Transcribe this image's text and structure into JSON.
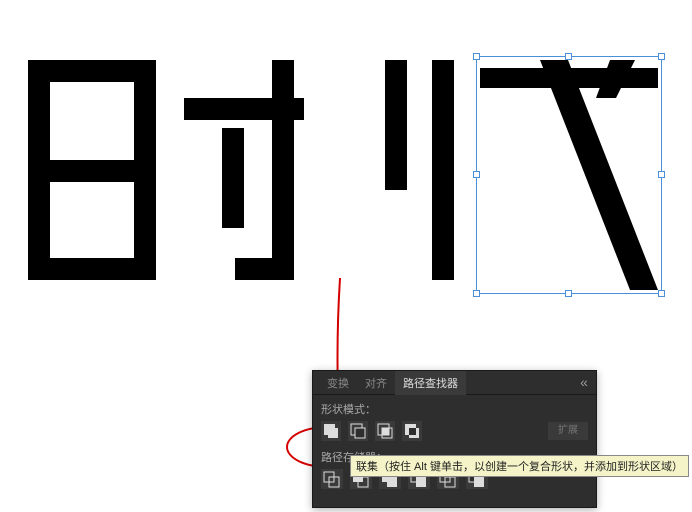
{
  "panel": {
    "tabs": {
      "transform": "变换",
      "align": "对齐",
      "pathfinder": "路径查找器"
    },
    "shape_mode_label": "形状模式：",
    "pathfinders_label": "路径存储器：",
    "expand_label": "扩展",
    "close_glyph": "«"
  },
  "tooltip": {
    "text": "联集（按住 Alt 键单击，以创建一个复合形状，并添加到形状区域）"
  },
  "icons": {
    "unite": "unite",
    "minus_front": "minus-front",
    "intersect": "intersect",
    "exclude": "exclude",
    "divide": "divide",
    "trim": "trim",
    "merge": "merge",
    "crop": "crop",
    "outline": "outline",
    "minus_back": "minus-back"
  }
}
